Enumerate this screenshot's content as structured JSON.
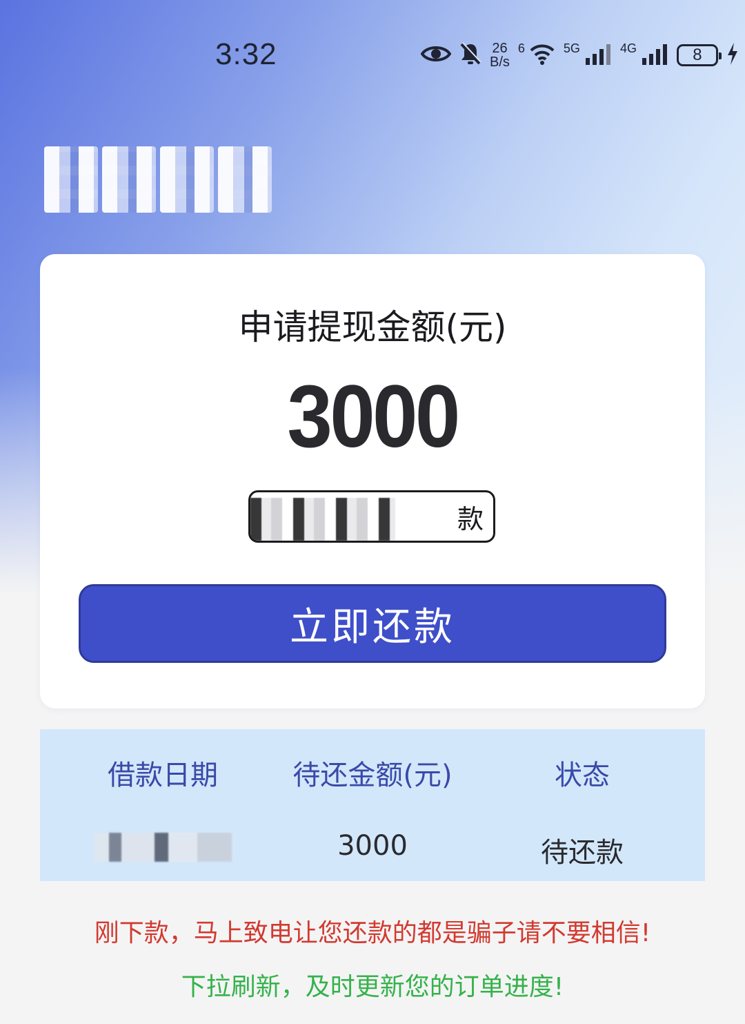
{
  "status_bar": {
    "time": "3:32",
    "net_speed_value": "26",
    "net_speed_unit": "B/s",
    "wifi_label": "6",
    "sig1_label": "5G",
    "sig2_label": "4G",
    "battery_level": "8"
  },
  "card": {
    "label": "申请提现金额(元)",
    "amount": "3000",
    "due_note_suffix": "款",
    "repay_button_label": "立即还款"
  },
  "table": {
    "headers": [
      "借款日期",
      "待还金额(元)",
      "状态"
    ],
    "rows": [
      {
        "amount": "3000",
        "status": "待还款"
      }
    ]
  },
  "notices": {
    "warning": "刚下款，马上致电让您还款的都是骗子请不要相信!",
    "refresh": "下拉刷新，及时更新您的订单进度!"
  },
  "colors": {
    "primary_button": "#3f4fc9",
    "warning_text": "#d23a2f",
    "refresh_text": "#35b24a",
    "table_bg": "#d3e7fb"
  }
}
